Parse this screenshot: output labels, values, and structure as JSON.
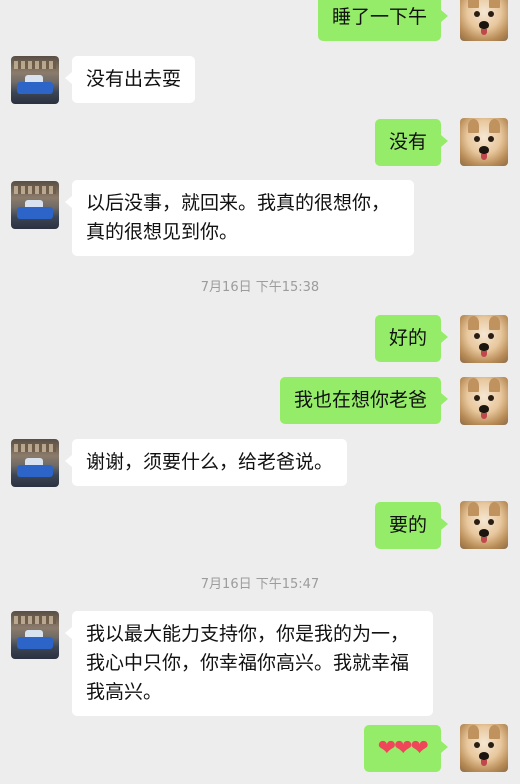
{
  "colors": {
    "background": "#ededed",
    "incoming_bubble": "#ffffff",
    "outgoing_bubble": "#95ec69",
    "timestamp_text": "#9c9c9c"
  },
  "messages": [
    {
      "side": "out",
      "text": "睡了一下午"
    },
    {
      "side": "in",
      "text": "没有出去耍"
    },
    {
      "side": "out",
      "text": "没有"
    },
    {
      "side": "in",
      "text": "以后没事，就回来。我真的很想你，真的很想见到你。"
    },
    {
      "side": "out",
      "text": "好的"
    },
    {
      "side": "out",
      "text": "我也在想你老爸"
    },
    {
      "side": "in",
      "text": "谢谢，须要什么，给老爸说。"
    },
    {
      "side": "out",
      "text": "要的"
    },
    {
      "side": "in",
      "text": "我以最大能力支持你，你是我的为一，我心中只你，你幸福你高兴。我就幸福我高兴。"
    },
    {
      "side": "out",
      "text": "❤❤❤"
    }
  ],
  "timestamps": [
    "7月16日 下午15:38",
    "7月16日 下午15:47"
  ]
}
